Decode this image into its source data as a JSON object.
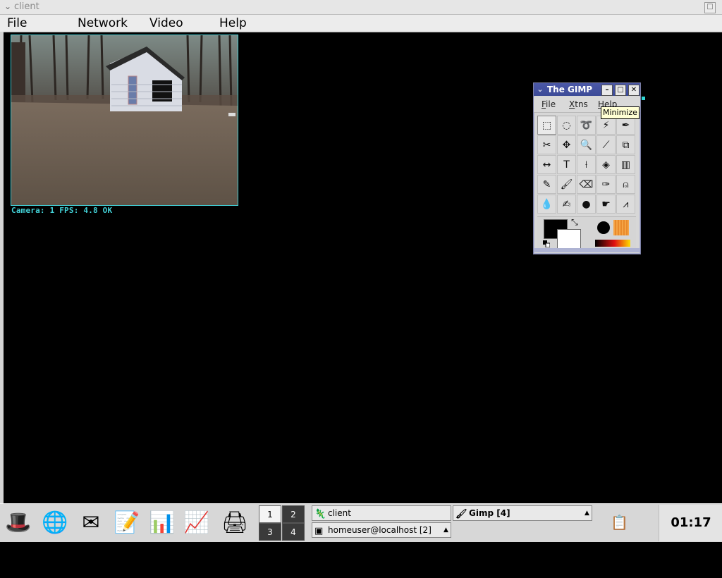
{
  "main_window": {
    "title": "client",
    "menu": [
      "File",
      "Network",
      "Video",
      "Help"
    ],
    "status_text": "Camera: 1 FPS: 4.8 OK"
  },
  "gimp": {
    "title": "The GIMP",
    "menu": [
      {
        "label": "File",
        "underline": "F",
        "rest": "ile"
      },
      {
        "label": "Xtns",
        "underline": "X",
        "rest": "tns"
      },
      {
        "label": "Help",
        "underline": "H",
        "rest": "elp"
      }
    ],
    "tooltip": "Minimize",
    "tools": [
      {
        "name": "rect-select-tool-icon",
        "glyph": "⬚"
      },
      {
        "name": "ellipse-select-tool-icon",
        "glyph": "◌"
      },
      {
        "name": "free-select-tool-icon",
        "glyph": "➰"
      },
      {
        "name": "fuzzy-select-tool-icon",
        "glyph": "⚡"
      },
      {
        "name": "bezier-select-tool-icon",
        "glyph": "✒"
      },
      {
        "name": "scissors-select-tool-icon",
        "glyph": "✂"
      },
      {
        "name": "move-tool-icon",
        "glyph": "✥"
      },
      {
        "name": "magnify-tool-icon",
        "glyph": "🔍"
      },
      {
        "name": "crop-tool-icon",
        "glyph": "⟋"
      },
      {
        "name": "transform-tool-icon",
        "glyph": "⧉"
      },
      {
        "name": "flip-tool-icon",
        "glyph": "↔"
      },
      {
        "name": "text-tool-icon",
        "glyph": "T"
      },
      {
        "name": "color-picker-tool-icon",
        "glyph": "⟊"
      },
      {
        "name": "bucket-fill-tool-icon",
        "glyph": "◈"
      },
      {
        "name": "blend-tool-icon",
        "glyph": "▥"
      },
      {
        "name": "pencil-tool-icon",
        "glyph": "✎"
      },
      {
        "name": "paintbrush-tool-icon",
        "glyph": "🖌"
      },
      {
        "name": "eraser-tool-icon",
        "glyph": "⌫"
      },
      {
        "name": "airbrush-tool-icon",
        "glyph": "✑"
      },
      {
        "name": "clone-tool-icon",
        "glyph": "⍝"
      },
      {
        "name": "blur-tool-icon",
        "glyph": "💧"
      },
      {
        "name": "ink-tool-icon",
        "glyph": "✍"
      },
      {
        "name": "dodge-burn-tool-icon",
        "glyph": "●"
      },
      {
        "name": "smudge-tool-icon",
        "glyph": "☛"
      },
      {
        "name": "measure-tool-icon",
        "glyph": "⩘"
      }
    ]
  },
  "taskbar": {
    "pager": [
      "1",
      "2",
      "3",
      "4"
    ],
    "tasks": [
      {
        "label": "client",
        "icon": "gimp-icon",
        "glyph": "🦎"
      },
      {
        "label": "Gimp [4]",
        "icon": "gimp-icon",
        "glyph": "🖌"
      },
      {
        "label": "homeuser@localhost [2]",
        "icon": "terminal-icon",
        "glyph": "▣"
      }
    ],
    "clock": "01:17 pm"
  },
  "colors": {
    "gimp_title": "#3c4b98",
    "cam_border": "#43cfd6",
    "status_text": "#43d2d8"
  }
}
